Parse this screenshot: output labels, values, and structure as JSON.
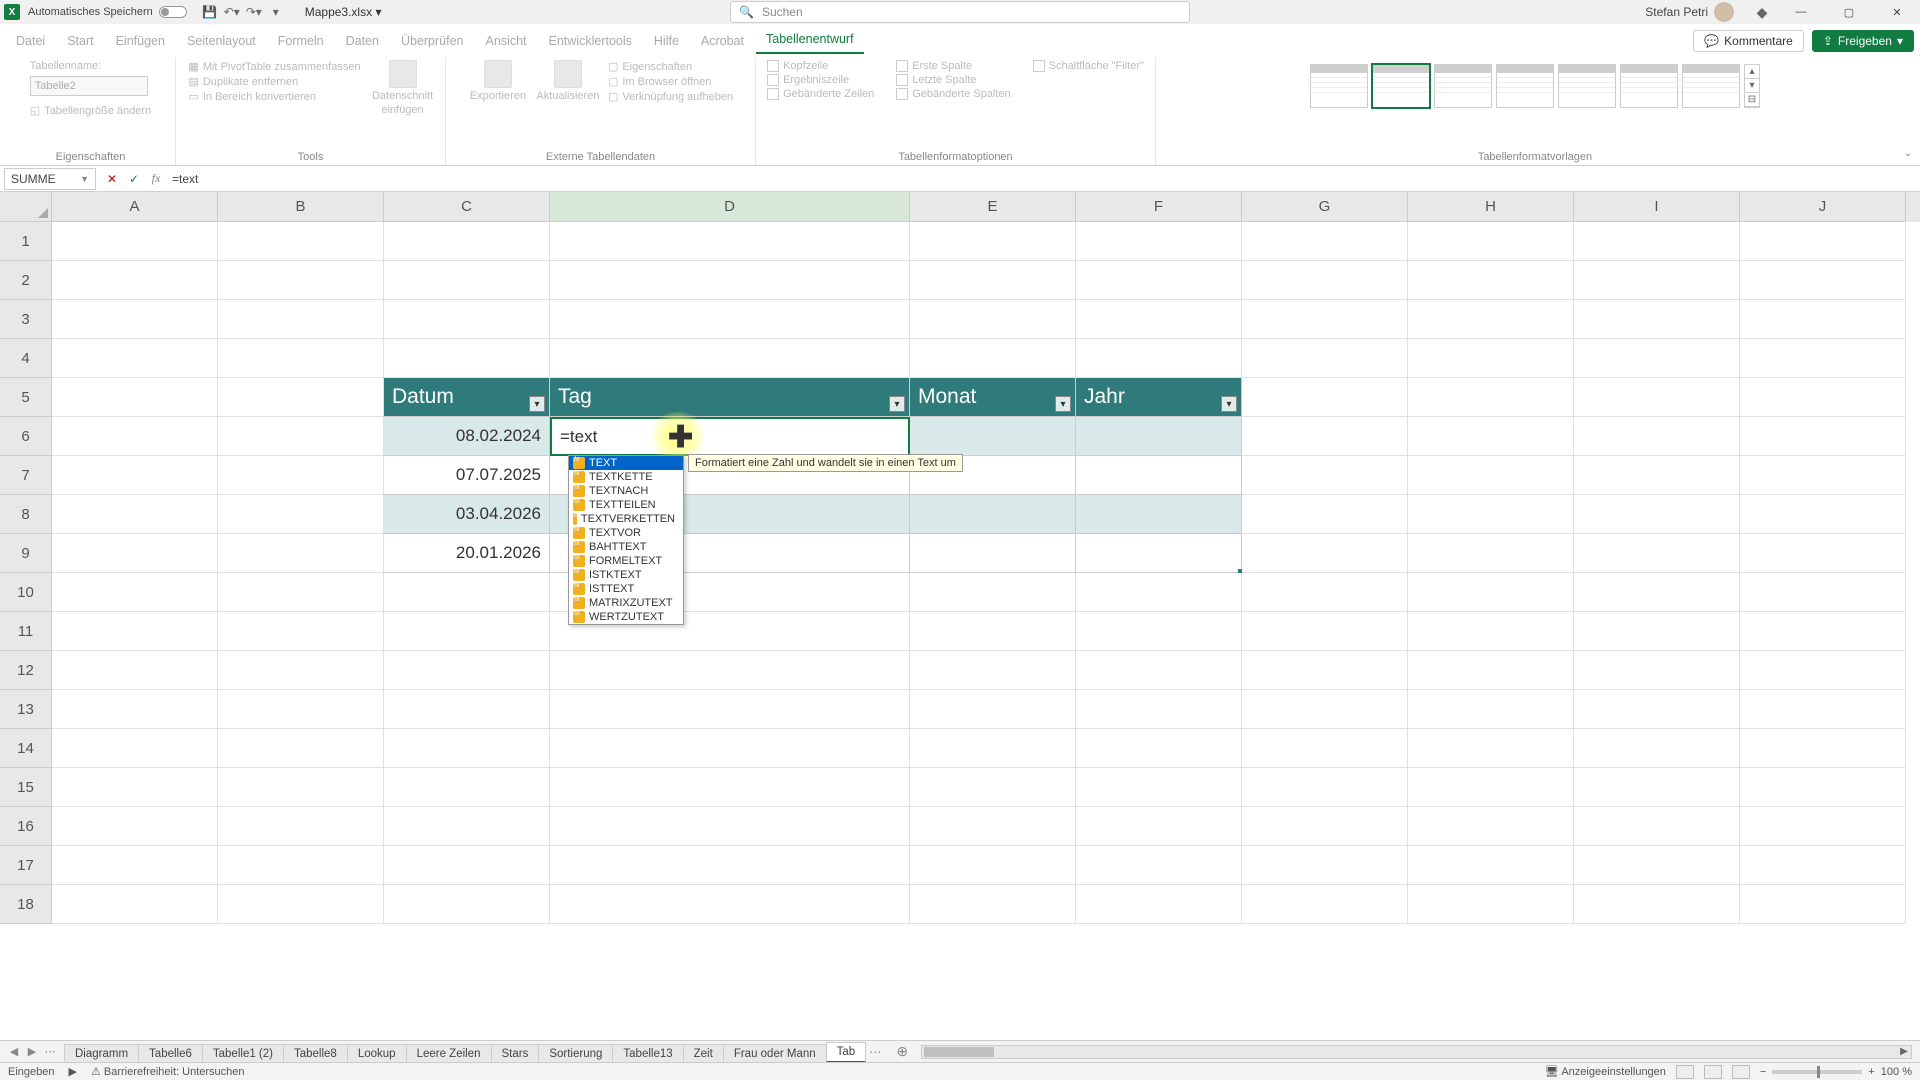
{
  "title": {
    "autosave": "Automatisches Speichern",
    "filename": "Mappe3.xlsx",
    "search_placeholder": "Suchen",
    "username": "Stefan Petri"
  },
  "tabs": {
    "file": "Datei",
    "items": [
      "Start",
      "Einfügen",
      "Seitenlayout",
      "Formeln",
      "Daten",
      "Überprüfen",
      "Ansicht",
      "Entwicklertools",
      "Hilfe",
      "Acrobat",
      "Tabellenentwurf"
    ],
    "active": "Tabellenentwurf",
    "comments": "Kommentare",
    "share": "Freigeben"
  },
  "ribbon": {
    "props": {
      "tablename_label": "Tabellenname:",
      "tablename_value": "Tabelle2",
      "resize": "Tabellengröße ändern",
      "group": "Eigenschaften"
    },
    "tools": {
      "pivot": "Mit PivotTable zusammenfassen",
      "dedup": "Duplikate entfernen",
      "convert": "In Bereich konvertieren",
      "slicer_top": "Datenschnitt",
      "slicer_bot": "einfügen",
      "group": "Tools"
    },
    "extern": {
      "export": "Exportieren",
      "refresh": "Aktualisieren",
      "props": "Eigenschaften",
      "browser": "Im Browser öffnen",
      "unlink": "Verknüpfung aufheben",
      "group": "Externe Tabellendaten"
    },
    "styleopts": {
      "header": "Kopfzeile",
      "total": "Ergebniszeile",
      "banded_rows": "Gebänderte Zeilen",
      "first_col": "Erste Spalte",
      "last_col": "Letzte Spalte",
      "banded_cols": "Gebänderte Spalten",
      "filter": "Schaltfläche \"Filter\"",
      "group": "Tabellenformatoptionen"
    },
    "styles_group": "Tabellenformatvorlagen"
  },
  "formulabar": {
    "name": "SUMME",
    "formula": "=text"
  },
  "grid": {
    "cols": [
      "A",
      "B",
      "C",
      "D",
      "E",
      "F",
      "G",
      "H",
      "I",
      "J"
    ],
    "rows_visible": 18,
    "table": {
      "headers": {
        "datum": "Datum",
        "tag": "Tag",
        "monat": "Monat",
        "jahr": "Jahr"
      },
      "rows": [
        {
          "datum": "08.02.2024"
        },
        {
          "datum": "07.07.2025"
        },
        {
          "datum": "03.04.2026"
        },
        {
          "datum": "20.01.2026"
        }
      ],
      "editing_value": "=text"
    }
  },
  "autocomplete": {
    "tooltip": "Formatiert eine Zahl und wandelt sie in einen Text um",
    "items": [
      "TEXT",
      "TEXTKETTE",
      "TEXTNACH",
      "TEXTTEILEN",
      "TEXTVERKETTEN",
      "TEXTVOR",
      "BAHTTEXT",
      "FORMELTEXT",
      "ISTKTEXT",
      "ISTTEXT",
      "MATRIXZUTEXT",
      "WERTZUTEXT"
    ],
    "selected": "TEXT"
  },
  "sheets": {
    "tabs": [
      "Diagramm",
      "Tabelle6",
      "Tabelle1 (2)",
      "Tabelle8",
      "Lookup",
      "Leere Zeilen",
      "Stars",
      "Sortierung",
      "Tabelle13",
      "Zeit",
      "Frau oder Mann",
      "Tab"
    ],
    "active": "Tab"
  },
  "status": {
    "mode": "Eingeben",
    "access": "Barrierefreiheit: Untersuchen",
    "display": "Anzeigeeinstellungen",
    "zoom": "100 %"
  }
}
